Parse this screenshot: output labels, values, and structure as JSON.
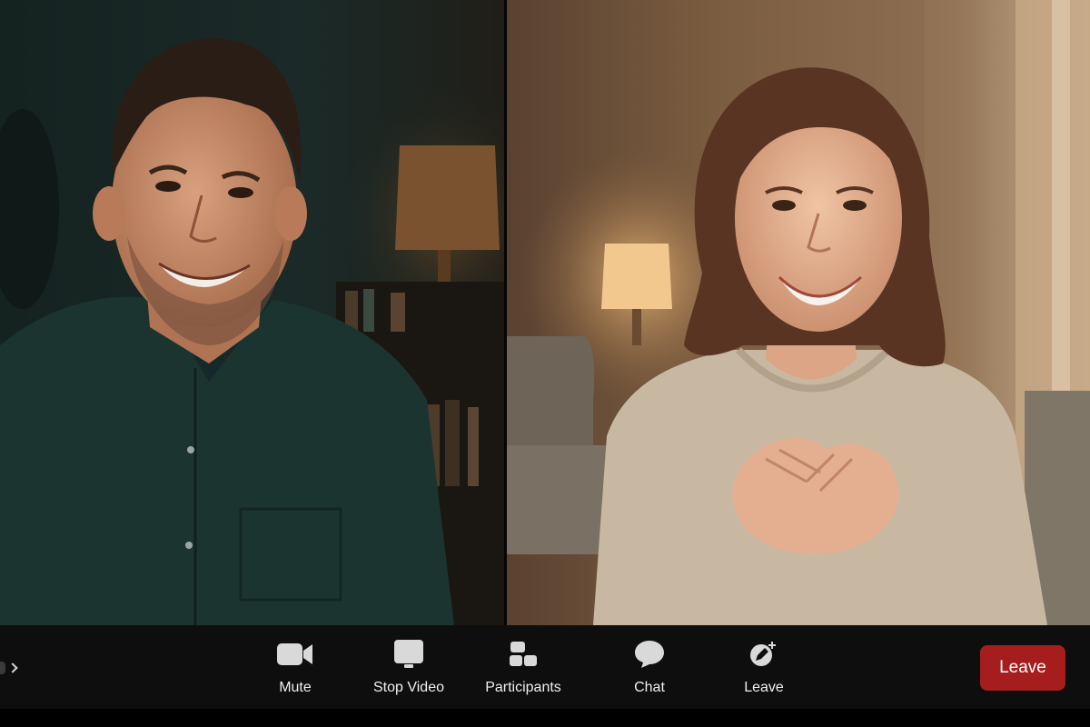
{
  "video": {
    "participants": [
      {
        "tile": "left",
        "depiction": "smiling man in dark green shirt"
      },
      {
        "tile": "right",
        "depiction": "smiling woman in beige sweater"
      }
    ]
  },
  "toolbar": {
    "mute_label": "Mute",
    "stop_video_label": "Stop Video",
    "participants_label": "Participants",
    "chat_label": "Chat",
    "leave_tool_label": "Leave",
    "leave_button_label": "Leave"
  },
  "colors": {
    "toolbar_bg": "#0e0e0e",
    "icon": "#d9d9d9",
    "leave_button": "#a51d1d"
  }
}
